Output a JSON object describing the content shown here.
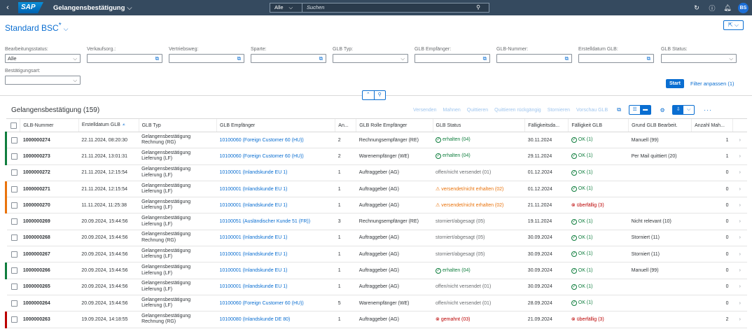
{
  "shell": {
    "back_icon": "‹",
    "logo": "SAP",
    "app_title": "Gelangensbestätigung",
    "search_scope": "Alle",
    "search_placeholder": "Suchen",
    "avatar": "BS"
  },
  "header": {
    "variant_title": "Standard BSC",
    "variant_modified": "*"
  },
  "filters": [
    {
      "label": "Bearbeitungsstatus:",
      "value": "Alle",
      "icon": "dropdown"
    },
    {
      "label": "Verkaufsorg.:",
      "value": "",
      "icon": "value-help"
    },
    {
      "label": "Vertriebsweg:",
      "value": "",
      "icon": "value-help"
    },
    {
      "label": "Sparte:",
      "value": "",
      "icon": "value-help"
    },
    {
      "label": "GLB Typ:",
      "value": "",
      "icon": "dropdown"
    },
    {
      "label": "GLB Empfänger:",
      "value": "",
      "icon": "value-help"
    },
    {
      "label": "GLB-Nummer:",
      "value": "",
      "icon": "value-help"
    },
    {
      "label": "Erstelldatum GLB:",
      "value": "",
      "icon": "value-help"
    },
    {
      "label": "GLB Status:",
      "value": "",
      "icon": "dropdown"
    },
    {
      "label": "Bestätigungsart:",
      "value": "",
      "icon": "dropdown"
    }
  ],
  "filterbar": {
    "start_label": "Start",
    "adapt_label": "Filter anpassen (1)"
  },
  "table": {
    "title": "Gelangensbestätigung (159)",
    "toolbar": [
      "Versenden",
      "Mahnen",
      "Quittieren",
      "Quittieren rückgängig",
      "Stornieren",
      "Vorschau GLB"
    ],
    "columns": [
      "GLB-Nummer",
      "Erstelldatum GLB",
      "GLB Typ",
      "GLB Empfänger",
      "An...",
      "GLB Rolle Empfänger",
      "GLB Status",
      "Fälligkeitsda...",
      "Fälligkeit GLB",
      "Grund GLB Bearbeit.",
      "Anzahl Mah..."
    ],
    "rows": [
      {
        "ind": "green",
        "nr": "1000000274",
        "date": "22.11.2024, 08:20:30",
        "typ1": "Gelangensbestätigung",
        "typ2": "Rechnung (RG)",
        "empf": "10100060 (Foreign Customer 60 (HU))",
        "an": "2",
        "rolle": "Rechnungsempfänger (RE)",
        "status": "erhalten (04)",
        "status_kind": "ok",
        "fdate": "30.11.2024",
        "faellig": "OK (1)",
        "faellig_kind": "ok",
        "grund": "Manuell (99)",
        "mahn": "1"
      },
      {
        "ind": "green",
        "nr": "1000000273",
        "date": "21.11.2024, 13:01:31",
        "typ1": "Gelangensbestätigung",
        "typ2": "Lieferung (LF)",
        "empf": "10100060 (Foreign Customer 60 (HU))",
        "an": "2",
        "rolle": "Warenempfänger (WE)",
        "status": "erhalten (04)",
        "status_kind": "ok",
        "fdate": "29.11.2024",
        "faellig": "OK (1)",
        "faellig_kind": "ok",
        "grund": "Per Mail quittiert (20)",
        "mahn": "1"
      },
      {
        "ind": "none",
        "nr": "1000000272",
        "date": "21.11.2024, 12:15:54",
        "typ1": "Gelangensbestätigung",
        "typ2": "Lieferung (LF)",
        "empf": "10100001 (Inlandskunde EU 1)",
        "an": "1",
        "rolle": "Auftraggeber (AG)",
        "status": "offen/nicht versendet (01)",
        "status_kind": "muted",
        "fdate": "01.12.2024",
        "faellig": "OK (1)",
        "faellig_kind": "ok",
        "grund": "",
        "mahn": "0"
      },
      {
        "ind": "orange",
        "nr": "1000000271",
        "date": "21.11.2024, 12:15:54",
        "typ1": "Gelangensbestätigung",
        "typ2": "Lieferung (LF)",
        "empf": "10100001 (Inlandskunde EU 1)",
        "an": "1",
        "rolle": "Auftraggeber (AG)",
        "status": "versendet/nicht erhalten (02)",
        "status_kind": "warn",
        "fdate": "01.12.2024",
        "faellig": "OK (1)",
        "faellig_kind": "ok",
        "grund": "",
        "mahn": "0"
      },
      {
        "ind": "orange",
        "nr": "1000000270",
        "date": "11.11.2024, 11:25:38",
        "typ1": "Gelangensbestätigung",
        "typ2": "Lieferung (LF)",
        "empf": "10100001 (Inlandskunde EU 1)",
        "an": "1",
        "rolle": "Auftraggeber (AG)",
        "status": "versendet/nicht erhalten (02)",
        "status_kind": "warn",
        "fdate": "21.11.2024",
        "faellig": "überfällig (3)",
        "faellig_kind": "err",
        "grund": "",
        "mahn": "0"
      },
      {
        "ind": "none",
        "nr": "1000000269",
        "date": "20.09.2024, 15:44:56",
        "typ1": "Gelangensbestätigung",
        "typ2": "Lieferung (LF)",
        "empf": "10100051 (Ausländischer Kunde 51 (FR))",
        "an": "3",
        "rolle": "Rechnungsempfänger (RE)",
        "status": "storniert/abgesagt (05)",
        "status_kind": "muted",
        "fdate": "19.11.2024",
        "faellig": "OK (1)",
        "faellig_kind": "ok",
        "grund": "Nicht relevant (10)",
        "mahn": "0"
      },
      {
        "ind": "none",
        "nr": "1000000268",
        "date": "20.09.2024, 15:44:56",
        "typ1": "Gelangensbestätigung",
        "typ2": "Rechnung (RG)",
        "empf": "10100001 (Inlandskunde EU 1)",
        "an": "1",
        "rolle": "Auftraggeber (AG)",
        "status": "storniert/abgesagt (05)",
        "status_kind": "muted",
        "fdate": "30.09.2024",
        "faellig": "OK (1)",
        "faellig_kind": "ok",
        "grund": "Storniert (11)",
        "mahn": "0"
      },
      {
        "ind": "none",
        "nr": "1000000267",
        "date": "20.09.2024, 15:44:56",
        "typ1": "Gelangensbestätigung",
        "typ2": "Lieferung (LF)",
        "empf": "10100001 (Inlandskunde EU 1)",
        "an": "1",
        "rolle": "Auftraggeber (AG)",
        "status": "storniert/abgesagt (05)",
        "status_kind": "muted",
        "fdate": "30.09.2024",
        "faellig": "OK (1)",
        "faellig_kind": "ok",
        "grund": "Storniert (11)",
        "mahn": "0"
      },
      {
        "ind": "green",
        "nr": "1000000266",
        "date": "20.09.2024, 15:44:56",
        "typ1": "Gelangensbestätigung",
        "typ2": "Lieferung (LF)",
        "empf": "10100001 (Inlandskunde EU 1)",
        "an": "1",
        "rolle": "Auftraggeber (AG)",
        "status": "erhalten (04)",
        "status_kind": "ok",
        "fdate": "30.09.2024",
        "faellig": "OK (1)",
        "faellig_kind": "ok",
        "grund": "Manuell (99)",
        "mahn": "0"
      },
      {
        "ind": "none",
        "nr": "1000000265",
        "date": "20.09.2024, 15:44:56",
        "typ1": "Gelangensbestätigung",
        "typ2": "Lieferung (LF)",
        "empf": "10100001 (Inlandskunde EU 1)",
        "an": "1",
        "rolle": "Auftraggeber (AG)",
        "status": "offen/nicht versendet (01)",
        "status_kind": "muted",
        "fdate": "30.09.2024",
        "faellig": "OK (1)",
        "faellig_kind": "ok",
        "grund": "",
        "mahn": "0"
      },
      {
        "ind": "none",
        "nr": "1000000264",
        "date": "20.09.2024, 15:44:56",
        "typ1": "Gelangensbestätigung",
        "typ2": "Lieferung (LF)",
        "empf": "10100060 (Foreign Customer 60 (HU))",
        "an": "5",
        "rolle": "Warenempfänger (WE)",
        "status": "offen/nicht versendet (01)",
        "status_kind": "muted",
        "fdate": "28.09.2024",
        "faellig": "OK (1)",
        "faellig_kind": "ok",
        "grund": "",
        "mahn": "0"
      },
      {
        "ind": "red",
        "nr": "1000000263",
        "date": "19.09.2024, 14:18:55",
        "typ1": "Gelangensbestätigung",
        "typ2": "Rechnung (RG)",
        "empf": "10100080 (Inlandskunde DE 80)",
        "an": "1",
        "rolle": "Auftraggeber (AG)",
        "status": "gemahnt (03)",
        "status_kind": "err",
        "fdate": "21.09.2024",
        "faellig": "überfällig (3)",
        "faellig_kind": "err",
        "grund": "",
        "mahn": "2"
      }
    ]
  }
}
